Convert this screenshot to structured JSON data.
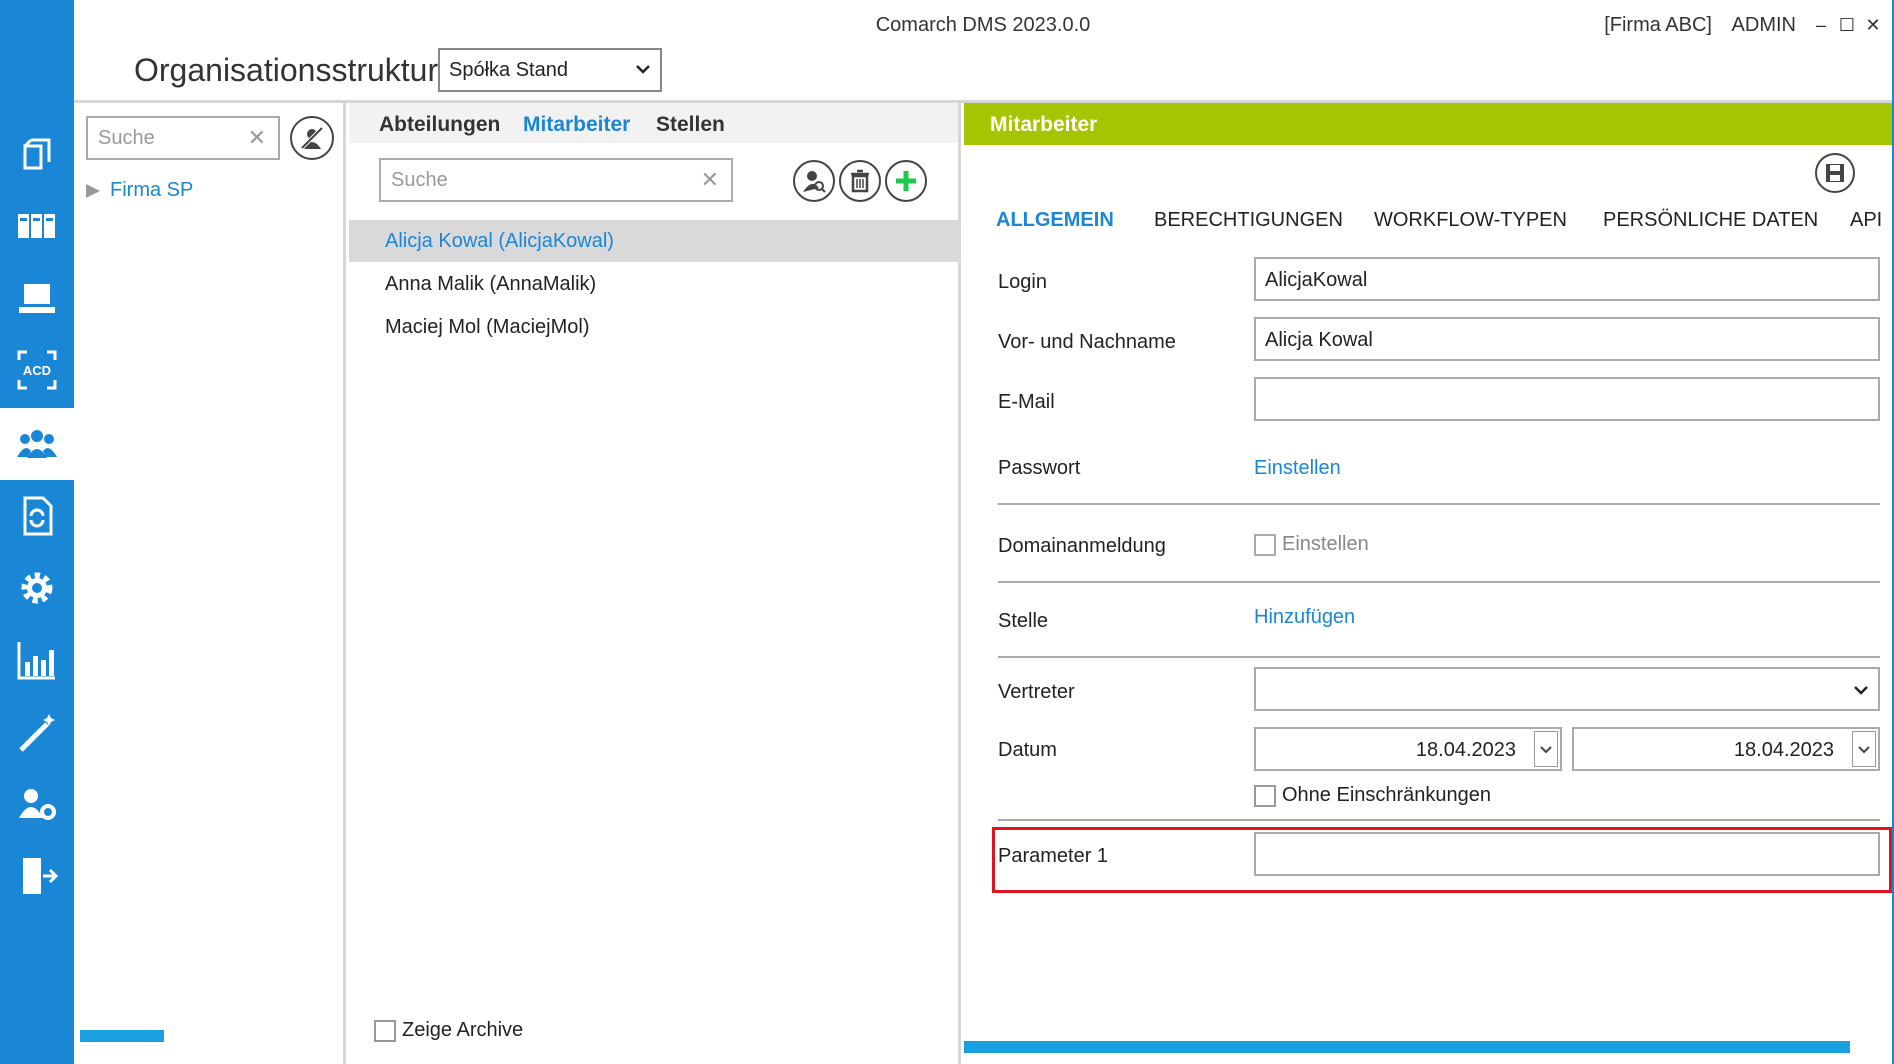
{
  "window": {
    "title": "Comarch DMS 2023.0.0",
    "company": "[Firma ABC]",
    "user": "ADMIN",
    "minimize": "–",
    "maximize": "☐",
    "close": "✕"
  },
  "header": {
    "title": "Organisationsstruktur",
    "company_select": "Spółka Stand"
  },
  "sidebar": {
    "items": [
      {
        "icon": "documents-icon"
      },
      {
        "icon": "binders-icon"
      },
      {
        "icon": "workstation-icon"
      },
      {
        "icon": "ocr-acd-icon"
      },
      {
        "icon": "users-group-icon",
        "active": true
      },
      {
        "icon": "document-sync-icon"
      },
      {
        "icon": "gear-icon"
      },
      {
        "icon": "reports-chart-icon"
      },
      {
        "icon": "magic-wand-icon"
      },
      {
        "icon": "user-settings-icon"
      },
      {
        "icon": "logout-door-icon"
      }
    ]
  },
  "tree": {
    "search_placeholder": "Suche",
    "node": "Firma SP"
  },
  "list": {
    "tabs": [
      "Abteilungen",
      "Mitarbeiter",
      "Stellen"
    ],
    "active_tab": "Mitarbeiter",
    "search_placeholder": "Suche",
    "items": [
      "Alicja Kowal (AlicjaKowal)",
      "Anna Malik (AnnaMalik)",
      "Maciej Mol (MaciejMol)"
    ],
    "selected_index": 0,
    "show_archive": "Zeige Archive"
  },
  "detail": {
    "header": "Mitarbeiter",
    "tabs": [
      "ALLGEMEIN",
      "BERECHTIGUNGEN",
      "WORKFLOW-TYPEN",
      "PERSÖNLICHE DATEN",
      "API"
    ],
    "active_tab": "ALLGEMEIN",
    "login_label": "Login",
    "login_value": "AlicjaKowal",
    "name_label": "Vor- und Nachname",
    "name_value": "Alicja Kowal",
    "email_label": "E-Mail",
    "email_value": "",
    "password_label": "Passwort",
    "password_link": "Einstellen",
    "domain_label": "Domainanmeldung",
    "domain_checkbox": "Einstellen",
    "position_label": "Stelle",
    "position_link": "Hinzufügen",
    "substitute_label": "Vertreter",
    "substitute_value": "",
    "date_label": "Datum",
    "date_from": "18.04.2023",
    "date_to": "18.04.2023",
    "no_limits": "Ohne Einschränkungen",
    "param1_label": "Parameter 1",
    "param1_value": ""
  },
  "colors": {
    "sidebar": "#1a86d6",
    "accent": "#1a86d6",
    "detail_header": "#a6c400",
    "highlight": "#e0141e"
  }
}
